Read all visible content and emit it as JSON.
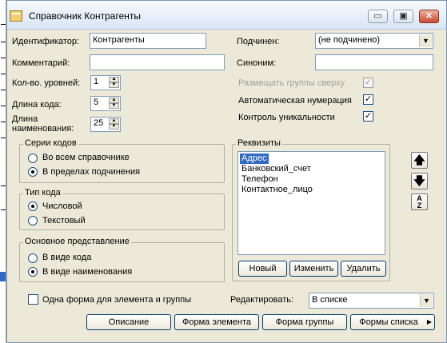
{
  "window": {
    "title": "Справочник Контрагенты",
    "minimize_glyph": "▭",
    "maximize_glyph": "▣",
    "close_glyph": "✕"
  },
  "left": {
    "identifier_label": "Идентификатор:",
    "identifier_value": "Контрагенты",
    "comment_label": "Комментарий:",
    "comment_value": "",
    "levels_label": "Кол-во. уровней:",
    "levels_value": "1",
    "code_len_label": "Длина кода:",
    "code_len_value": "5",
    "name_len_label_1": "Длина",
    "name_len_label_2": "наименования:",
    "name_len_value": "25"
  },
  "right": {
    "parent_label": "Подчинен:",
    "parent_value": "(не подчинено)",
    "synonym_label": "Синоним:",
    "synonym_value": "",
    "groups_top_label": "Размещать группы сверху",
    "groups_top_checked": true,
    "auto_num_label": "Автоматическая нумерация",
    "auto_num_checked": true,
    "unique_label": "Контроль уникальности",
    "unique_checked": true
  },
  "code_series": {
    "title": "Серии кодов",
    "options": [
      "Во всем справочнике",
      "В пределах подчинения"
    ],
    "selected": 1
  },
  "code_type": {
    "title": "Тип кода",
    "options": [
      "Числовой",
      "Текстовый"
    ],
    "selected": 0
  },
  "main_view": {
    "title": "Основное представление",
    "options": [
      "В виде кода",
      "В виде наименования"
    ],
    "selected": 1
  },
  "requisites": {
    "title": "Реквизиты",
    "items": [
      "Адрес",
      "Банковский_счет",
      "Телефон",
      "Контактное_лицо"
    ],
    "selected": 0,
    "new_label": "Новый",
    "edit_label": "Изменить",
    "delete_label": "Удалить"
  },
  "bottom": {
    "one_form_label": "Одна форма для элемента и группы",
    "one_form_checked": false,
    "edit_label": "Редактировать:",
    "edit_value": "В списке",
    "description_btn": "Описание",
    "element_form_btn": "Форма элемента",
    "group_form_btn": "Форма группы",
    "list_forms_btn": "Формы списка"
  }
}
